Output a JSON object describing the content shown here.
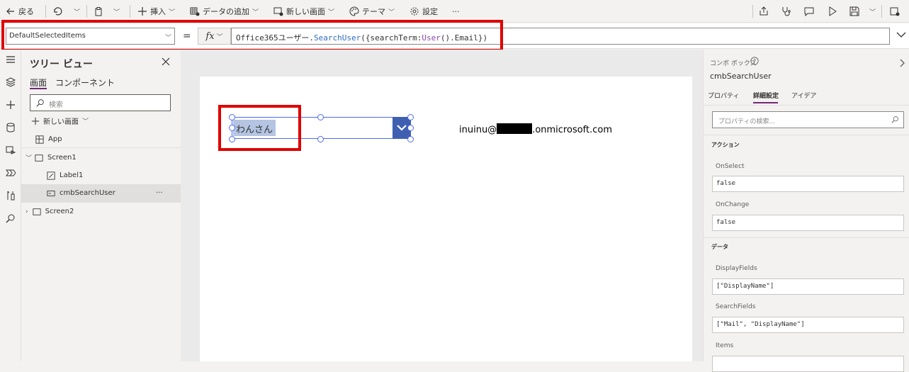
{
  "toolbar": {
    "back": "戻る",
    "insert": "挿入",
    "add_data": "データの追加",
    "new_screen": "新しい画面",
    "theme": "テーマ",
    "settings": "設定",
    "more": "···"
  },
  "formula_bar": {
    "property": "DefaultSelectedItems",
    "equals": "=",
    "fx": "fx",
    "formula_part1": "Office365ユーザー",
    "formula_part2": ".",
    "formula_part3": "SearchUser",
    "formula_part4": "({searchTerm:",
    "formula_part5": "User",
    "formula_part6": "().",
    "formula_part7": "Email",
    "formula_part8": "})"
  },
  "tree": {
    "title": "ツリー ビュー",
    "tabs": [
      "画面",
      "コンポーネント"
    ],
    "search_placeholder": "検索",
    "new_screen": "新しい画面",
    "items": [
      "App",
      "Screen1",
      "Label1",
      "cmbSearchUser",
      "Screen2"
    ],
    "more": "···"
  },
  "canvas": {
    "combo_selected": "わんさん",
    "email_prefix": "inuinu@",
    "email_suffix": ".onmicrosoft.com"
  },
  "props": {
    "control_type": "コンボ ボックス",
    "control_name": "cmbSearchUser",
    "tabs": [
      "プロパティ",
      "詳細設定",
      "アイデア"
    ],
    "search_placeholder": "プロパティの検索...",
    "section_action": "アクション",
    "onselect_label": "OnSelect",
    "onselect_value": "false",
    "onchange_label": "OnChange",
    "onchange_value": "false",
    "section_data": "データ",
    "displayfields_label": "DisplayFields",
    "displayfields_value": "[\"DisplayName\"]",
    "searchfields_label": "SearchFields",
    "searchfields_value": "[\"Mail\", \"DisplayName\"]",
    "items_label": "Items"
  },
  "colors": {
    "accent": "#742774",
    "highlight_red": "#e00000",
    "combo_button": "#3f5fb0",
    "selection": "#b4c4e2"
  }
}
